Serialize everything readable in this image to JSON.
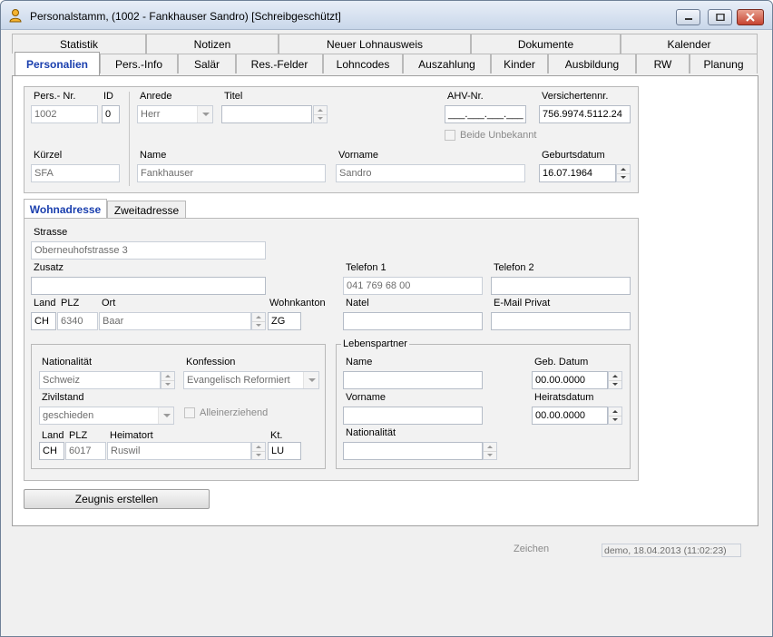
{
  "window": {
    "title": "Personalstamm, (1002 - Fankhauser Sandro) [Schreibgeschützt]"
  },
  "tabs_top": [
    "Statistik",
    "Notizen",
    "Neuer Lohnausweis",
    "Dokumente",
    "Kalender"
  ],
  "tabs_bottom": [
    "Personalien",
    "Pers.-Info",
    "Salär",
    "Res.-Felder",
    "Lohncodes",
    "Auszahlung",
    "Kinder",
    "Ausbildung",
    "RW",
    "Planung"
  ],
  "personal": {
    "persnr_label": "Pers.- Nr.",
    "persnr": "1002",
    "id_label": "ID",
    "id": "0",
    "anrede_label": "Anrede",
    "anrede": "Herr",
    "titel_label": "Titel",
    "titel": "",
    "ahv_label": "AHV-Nr.",
    "ahv": "___.___.___.___",
    "versnr_label": "Versichertennr.",
    "versnr": "756.9974.5112.24",
    "beide_label": "Beide Unbekannt",
    "kuerzel_label": "Kürzel",
    "kuerzel": "SFA",
    "name_label": "Name",
    "name": "Fankhauser",
    "vorname_label": "Vorname",
    "vorname": "Sandro",
    "geburt_label": "Geburtsdatum",
    "geburt": "16.07.1964"
  },
  "subtabs": [
    "Wohnadresse",
    "Zweitadresse"
  ],
  "address": {
    "strasse_label": "Strasse",
    "strasse": "Oberneuhofstrasse 3",
    "zusatz_label": "Zusatz",
    "zusatz": "",
    "land_label": "Land",
    "plz_label": "PLZ",
    "ort_label": "Ort",
    "kanton_label": "Wohnkanton",
    "land": "CH",
    "plz": "6340",
    "ort": "Baar",
    "kanton": "ZG",
    "tel1_label": "Telefon 1",
    "tel1": "041 769 68 00",
    "tel2_label": "Telefon 2",
    "tel2": "",
    "natel_label": "Natel",
    "natel": "",
    "email_label": "E-Mail Privat",
    "email": ""
  },
  "person2": {
    "nat_label": "Nationalität",
    "nat": "Schweiz",
    "konf_label": "Konfession",
    "konf": "Evangelisch Reformiert",
    "zivil_label": "Zivilstand",
    "zivil": "geschieden",
    "allein_label": "Alleinerziehend",
    "land_label": "Land",
    "plz_label": "PLZ",
    "heimat_label": "Heimatort",
    "kt_label": "Kt.",
    "land": "CH",
    "plz": "6017",
    "heimat": "Ruswil",
    "kt": "LU"
  },
  "partner": {
    "title": "Lebenspartner",
    "name_label": "Name",
    "name": "",
    "vorname_label": "Vorname",
    "vorname": "",
    "nat_label": "Nationalität",
    "nat": "",
    "geb_label": "Geb. Datum",
    "geb": "00.00.0000",
    "heirat_label": "Heiratsdatum",
    "heirat": "00.00.0000"
  },
  "buttons": {
    "zeugnis": "Zeugnis erstellen"
  },
  "footer": {
    "zeichen_label": "Zeichen",
    "zeichen": "demo, 18.04.2013 (11:02:23)"
  },
  "colors": {
    "accent": "#1a3fae",
    "close": "#c74431"
  }
}
